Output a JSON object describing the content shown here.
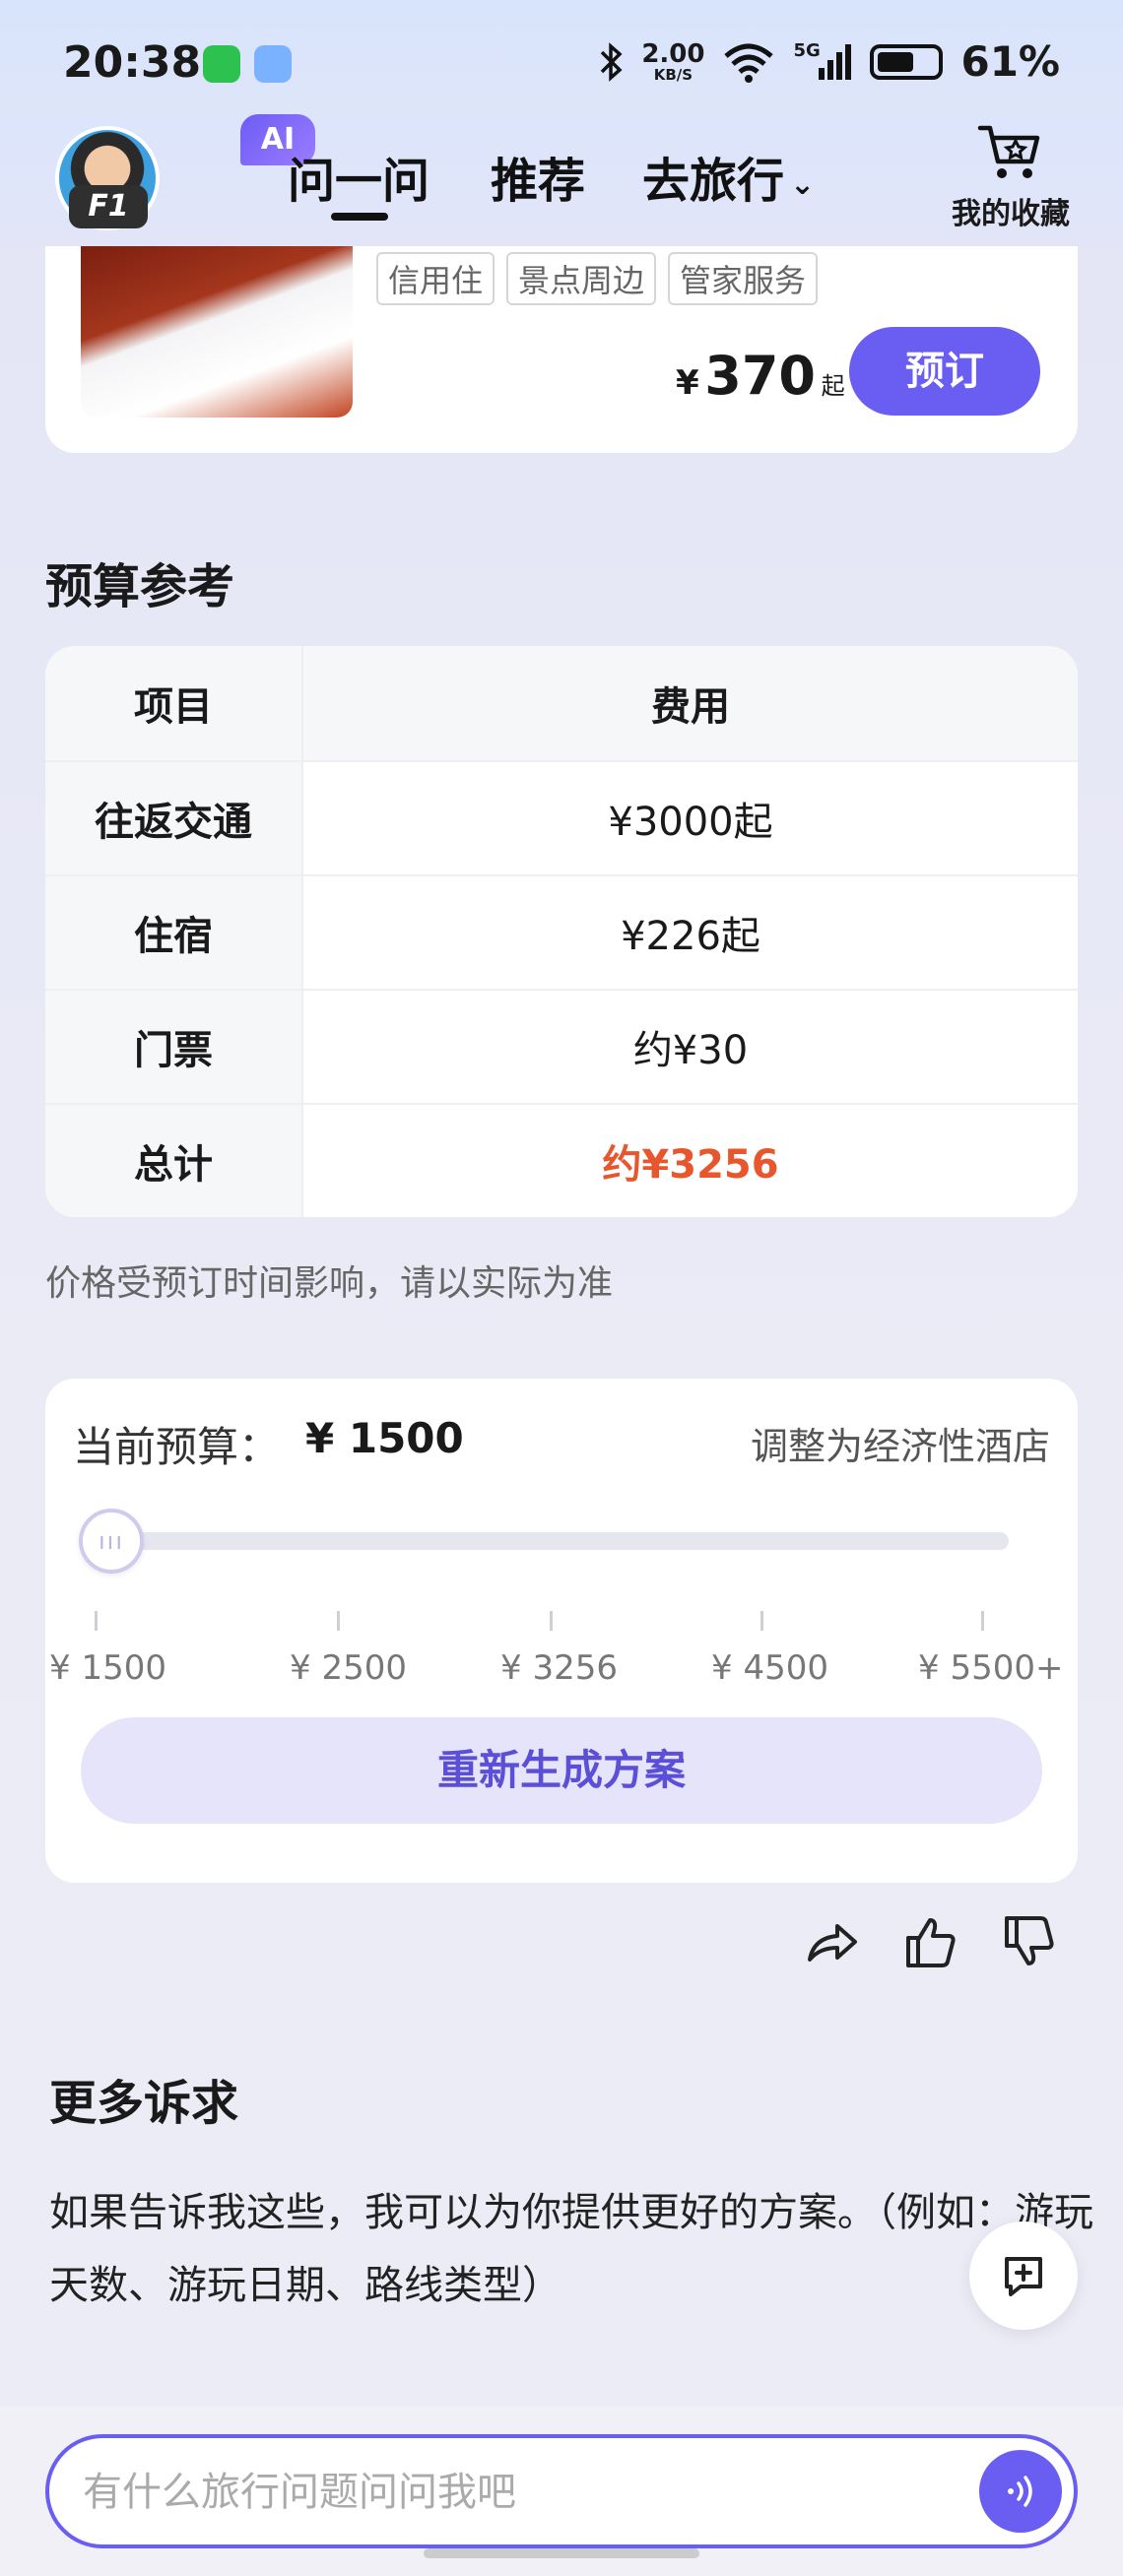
{
  "status_bar": {
    "time": "20:38",
    "speed": "2.00",
    "speed_unit": "KB/S",
    "network": "5G",
    "battery": "61%"
  },
  "header": {
    "ai_badge": "AI",
    "tabs": [
      "问一问",
      "推荐",
      "去旅行"
    ],
    "avatar_badge": "F1",
    "favorites_label": "我的收藏"
  },
  "hotel": {
    "tags": [
      "信用住",
      "景点周边",
      "管家服务"
    ],
    "currency": "¥",
    "price": "370",
    "price_suffix": "起",
    "book_label": "预订"
  },
  "budget": {
    "title": "预算参考",
    "header": {
      "item": "项目",
      "cost": "费用"
    },
    "rows": [
      {
        "item": "往返交通",
        "cost": "¥3000起"
      },
      {
        "item": "住宿",
        "cost": "¥226起"
      },
      {
        "item": "门票",
        "cost": "约¥30"
      }
    ],
    "total": {
      "item": "总计",
      "cost": "约¥3256"
    },
    "note": "价格受预订时间影响，请以实际为准",
    "colors": {
      "accent": "#6a5df2",
      "total": "#e8562d"
    }
  },
  "slider": {
    "current_label": "当前预算：",
    "current_value": "¥ 1500",
    "adjust_label": "调整为经济性酒店",
    "value_fraction": 0.0,
    "ticks": [
      "¥ 1500",
      "¥ 2500",
      "¥ 3256",
      "¥ 4500",
      "¥ 5500+"
    ],
    "regenerate_label": "重新生成方案"
  },
  "more": {
    "title": "更多诉求",
    "text": "如果告诉我这些，我可以为你提供更好的方案。（例如：游玩天数、游玩日期、路线类型）"
  },
  "input": {
    "placeholder": "有什么旅行问题问问我吧"
  }
}
